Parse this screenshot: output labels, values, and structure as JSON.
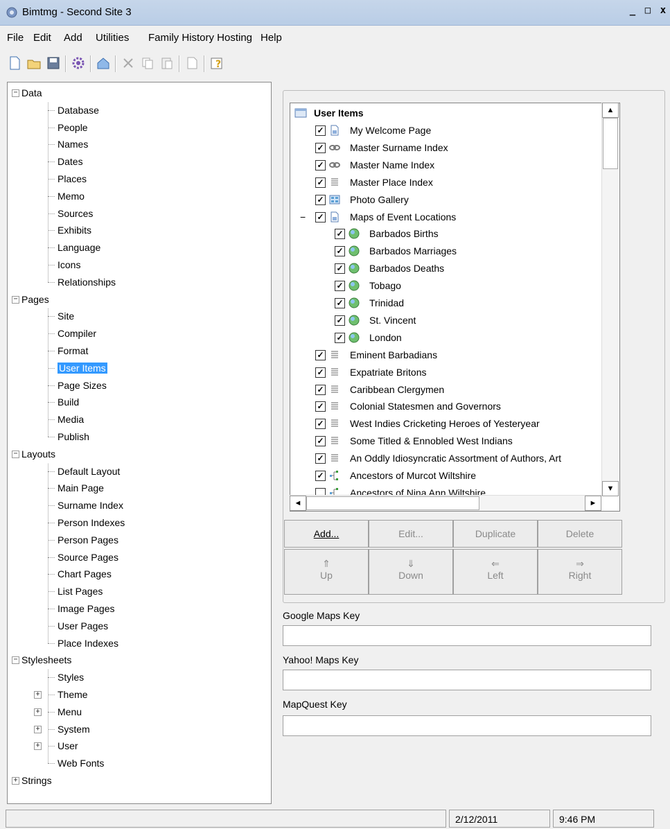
{
  "window": {
    "title": "Bimtmg - Second Site 3",
    "minimize": "_",
    "maximize": "□",
    "close": "x"
  },
  "menu": [
    "File",
    "Edit",
    "Add",
    "Utilities",
    "Family History Hosting",
    "Help"
  ],
  "tree": {
    "data": "Data",
    "data_items": [
      "Database",
      "People",
      "Names",
      "Dates",
      "Places",
      "Memo",
      "Sources",
      "Exhibits",
      "Language",
      "Icons",
      "Relationships"
    ],
    "pages": "Pages",
    "pages_items": [
      "Site",
      "Compiler",
      "Format",
      "User Items",
      "Page Sizes",
      "Build",
      "Media",
      "Publish"
    ],
    "layouts": "Layouts",
    "layouts_items": [
      "Default Layout",
      "Main Page",
      "Surname Index",
      "Person Indexes",
      "Person Pages",
      "Source Pages",
      "Chart Pages",
      "List Pages",
      "Image Pages",
      "User Pages",
      "Place Indexes"
    ],
    "stylesheets": "Stylesheets",
    "stylesheets_items": [
      "Styles",
      "Theme",
      "Menu",
      "System",
      "User",
      "Web Fonts"
    ],
    "strings": "Strings"
  },
  "user_items": {
    "root": "User Items",
    "rows": [
      {
        "label": "My Welcome  Page",
        "level": 1
      },
      {
        "label": "Master Surname  Index",
        "level": 1
      },
      {
        "label": "Master Name Index",
        "level": 1
      },
      {
        "label": "Master Place Index",
        "level": 1
      },
      {
        "label": "Photo Gallery",
        "level": 1
      },
      {
        "label": "Maps of Event Locations",
        "level": 1
      },
      {
        "label": "Barbados Births",
        "level": 2
      },
      {
        "label": "Barbados Marriages",
        "level": 2
      },
      {
        "label": "Barbados Deaths",
        "level": 2
      },
      {
        "label": "Tobago",
        "level": 2
      },
      {
        "label": "Trinidad",
        "level": 2
      },
      {
        "label": "St. Vincent",
        "level": 2
      },
      {
        "label": "London",
        "level": 2
      },
      {
        "label": "Eminent  Barbadians",
        "level": 1
      },
      {
        "label": "Expatriate  Britons",
        "level": 1
      },
      {
        "label": "Caribbean  Clergymen",
        "level": 1
      },
      {
        "label": "Colonial Statesmen  and Governors",
        "level": 1
      },
      {
        "label": "West Indies Cricketing Heroes of Yesteryear",
        "level": 1
      },
      {
        "label": "Some Titled & Ennobled West Indians",
        "level": 1
      },
      {
        "label": "An Oddly Idiosyncratic Assortment of Authors, Art",
        "level": 1
      },
      {
        "label": "Ancestors of Murcot Wiltshire",
        "level": 1
      },
      {
        "label": "Ancestors of Nina Ann Wiltshire",
        "level": 1
      }
    ]
  },
  "buttons": {
    "add": "Add...",
    "edit": "Edit...",
    "duplicate": "Duplicate",
    "delete": "Delete",
    "up_arrow": "⇑",
    "up": "Up",
    "down_arrow": "⇓",
    "down": "Down",
    "left_arrow": "⇐",
    "left": "Left",
    "right_arrow": "⇒",
    "right": "Right"
  },
  "fields": {
    "google_label": "Google Maps Key",
    "google_value": "",
    "yahoo_label": "Yahoo! Maps Key",
    "yahoo_value": "",
    "mapquest_label": "MapQuest Key",
    "mapquest_value": ""
  },
  "status": {
    "date": "2/12/2011",
    "time": "9:46 PM"
  }
}
